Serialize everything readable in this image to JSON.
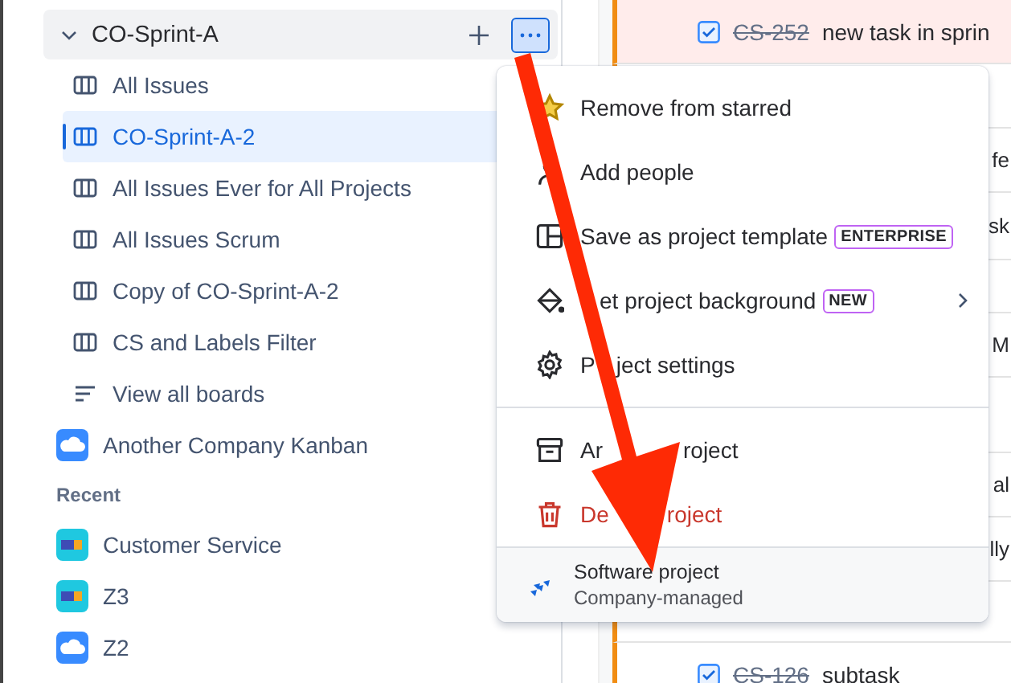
{
  "sidebar": {
    "project": {
      "name": "CO-Sprint-A",
      "expanded": true
    },
    "boards": [
      {
        "label": "All Issues",
        "selected": false,
        "kind": "board"
      },
      {
        "label": "CO-Sprint-A-2",
        "selected": true,
        "kind": "board"
      },
      {
        "label": "All Issues Ever for All Projects",
        "selected": false,
        "kind": "board"
      },
      {
        "label": "All Issues Scrum",
        "selected": false,
        "kind": "board"
      },
      {
        "label": "Copy of CO-Sprint-A-2",
        "selected": false,
        "kind": "board"
      },
      {
        "label": "CS and Labels Filter",
        "selected": false,
        "kind": "board"
      },
      {
        "label": "View all boards",
        "selected": false,
        "kind": "list"
      }
    ],
    "projects": [
      {
        "name": "Another Company Kanban",
        "kind": "cloud"
      }
    ],
    "recent_heading": "Recent",
    "recent": [
      {
        "name": "Customer Service",
        "kind": "box"
      },
      {
        "name": "Z3",
        "kind": "box"
      },
      {
        "name": "Z2",
        "kind": "cloud"
      }
    ]
  },
  "main": {
    "rows": [
      {
        "kind": "task",
        "key": "CS-252",
        "summary": "new task in sprin",
        "checked": true,
        "flagged": true
      },
      {
        "kind": "gap"
      },
      {
        "kind": "fragment",
        "text": "fe"
      },
      {
        "kind": "fragment",
        "text": "sk"
      },
      {
        "kind": "gap"
      },
      {
        "kind": "fragment",
        "text": "M"
      },
      {
        "kind": "gap"
      },
      {
        "kind": "fragment",
        "text": "al"
      },
      {
        "kind": "fragment",
        "text": "lly"
      },
      {
        "kind": "gap"
      },
      {
        "kind": "task",
        "key": "CS-126",
        "summary": "subtask",
        "checked": true,
        "flagged": false
      }
    ]
  },
  "menu": {
    "groups": [
      [
        {
          "label": "Remove from starred",
          "kind": "star"
        },
        {
          "label": "Add people",
          "kind": "person"
        },
        {
          "label": "Save as project template",
          "kind": "template",
          "badge": "ENTERPRISE"
        },
        {
          "label": [
            "et project background"
          ],
          "kind": "paint",
          "badge": "NEW",
          "submenu": true
        },
        {
          "label": [
            "P",
            "ject settings"
          ],
          "kind": "gear"
        }
      ],
      [
        {
          "label": [
            "Ar",
            "roject"
          ],
          "kind": "archive"
        },
        {
          "label": [
            "De",
            "roject"
          ],
          "kind": "trash",
          "danger": true
        }
      ]
    ],
    "footer": {
      "title": "Software project",
      "subtitle": "Company-managed"
    }
  }
}
